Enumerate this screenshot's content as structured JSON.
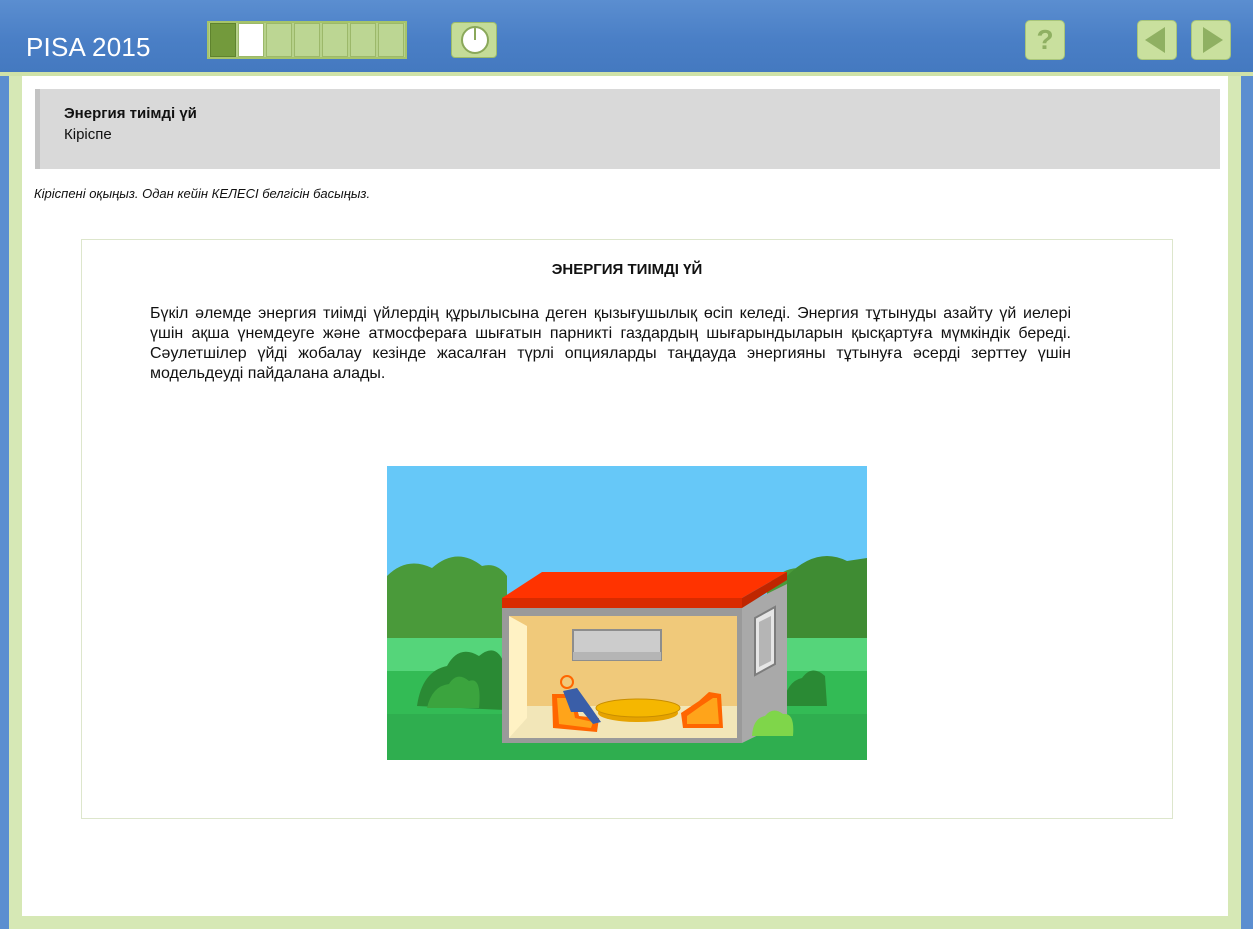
{
  "header": {
    "brand": "PISA 2015",
    "progress": {
      "total": 7,
      "completed": 1,
      "current": 2
    },
    "help_label": "?"
  },
  "unit": {
    "title": "Энергия тиімді үй",
    "subtitle": "Кіріспе"
  },
  "instruction": "Кіріспені оқыңыз. Одан кейін КЕЛЕСІ белгісін басыңыз.",
  "stimulus": {
    "title": "ЭНЕРГИЯ ТИІМДІ ҮЙ",
    "body": "Бүкіл әлемде энергия тиімді үйлердің құрылысына деген қызығушылық өсіп келеді. Энергия тұтынуды азайту үй иелері үшін ақша үнемдеуге және атмосфераға шығатын парникті газдардың шығарындыларын қысқартуға мүмкіндік береді. Сәулетшілер үйді жобалау кезінде жасалған түрлі опцияларды таңдауда энергияны тұтынуға әсерді зерттеу үшін модельдеуді пайдалана алады."
  },
  "colors": {
    "topbar": "#4a7fc6",
    "frame_green": "#d6e8b5",
    "progress_done": "#739a3c",
    "button_bg": "#c9e09e",
    "button_fg": "#8fb062",
    "sky": "#66c8f8",
    "roof": "#ff3300",
    "grass": "#33bb55"
  },
  "icons": {
    "help": "question-mark-icon",
    "back": "triangle-left-icon",
    "next": "triangle-right-icon",
    "timer": "clock-icon"
  }
}
